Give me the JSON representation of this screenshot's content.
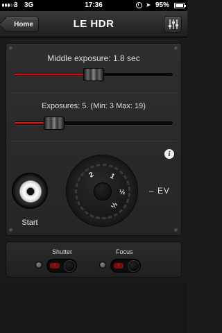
{
  "status_bar": {
    "carrier": "3",
    "network": "3G",
    "time": "17:36",
    "battery": "95%"
  },
  "nav": {
    "back_label": "Home",
    "title": "LE HDR",
    "settings_icon": "sliders-icon"
  },
  "middle_exposure": {
    "label": "Middle exposure: 1.8 sec",
    "value_fraction": 0.5
  },
  "exposures": {
    "label": "Exposures: 5. (Min: 3 Max: 19)",
    "value_fraction": 0.25
  },
  "info_icon": "i",
  "start": {
    "label": "Start"
  },
  "dial": {
    "marks": [
      "2",
      "1",
      "½",
      "⅓"
    ],
    "suffix": "– EV"
  },
  "toggles": [
    {
      "label": "Shutter",
      "state_mark": "I"
    },
    {
      "label": "Focus",
      "state_mark": "I"
    }
  ],
  "colors": {
    "accent_red": "#cc2222",
    "background": "#1b1b1b"
  }
}
